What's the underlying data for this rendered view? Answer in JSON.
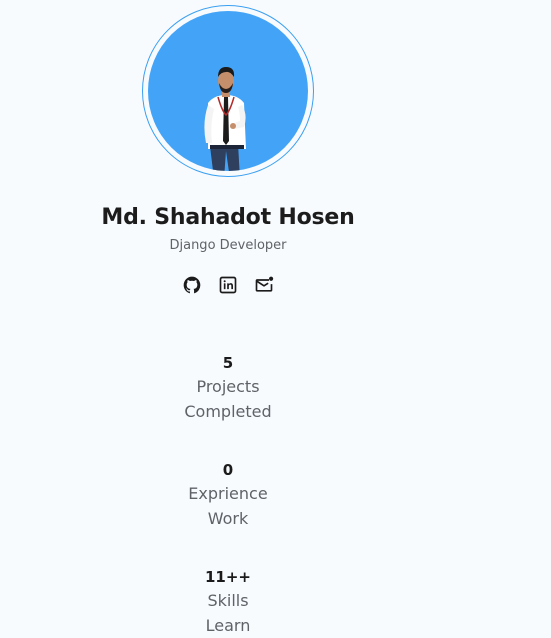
{
  "profile": {
    "name": "Md. Shahadot Hosen",
    "role": "Django Developer",
    "avatar_bg": "#43a4f7"
  },
  "socials": [
    {
      "icon": "github-icon"
    },
    {
      "icon": "linkedin-icon"
    },
    {
      "icon": "mail-icon"
    }
  ],
  "stats": [
    {
      "value": "5",
      "label_line1": "Projects",
      "label_line2": "Completed"
    },
    {
      "value": "0",
      "label_line1": "Exprience",
      "label_line2": "Work"
    },
    {
      "value": "11++",
      "label_line1": "Skills",
      "label_line2": "Learn"
    }
  ],
  "colors": {
    "accent": "#3a9ff2",
    "text_dark": "#1b1b1b",
    "text_muted": "#5f6368",
    "background": "#f8fbfe"
  }
}
